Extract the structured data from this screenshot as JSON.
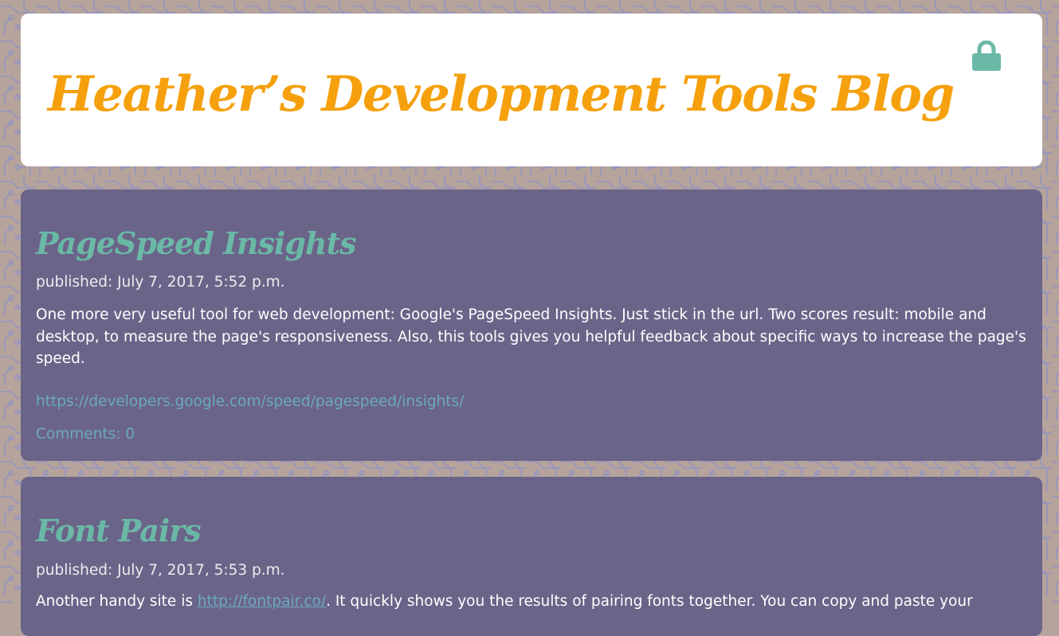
{
  "header": {
    "title": "Heather’s Development Tools Blog",
    "lock_icon": "lock-icon"
  },
  "posts": [
    {
      "title": "PageSpeed Insights",
      "published": "published: July 7, 2017, 5:52 p.m.",
      "body": "One more very useful tool for web development: Google's PageSpeed Insights. Just stick in the url. Two scores result: mobile and desktop, to measure the page's responsiveness. Also, this tools gives you helpful feedback about specific ways to increase the page's speed.",
      "link": "https://developers.google.com/speed/pagespeed/insights/",
      "comments": "Comments: 0"
    },
    {
      "title": "Font Pairs",
      "published": "published: July 7, 2017, 5:53 p.m.",
      "body_prefix": "Another handy site is ",
      "body_link": "http://fontpair.co/",
      "body_suffix": ". It quickly shows you the results of pairing fonts together. You can copy and paste your"
    }
  ],
  "colors": {
    "title_orange": "#f5a00c",
    "post_bg": "#6b6489",
    "post_title": "#6ab9a7",
    "link": "#6aa9be",
    "page_bg": "#b5a39c"
  }
}
